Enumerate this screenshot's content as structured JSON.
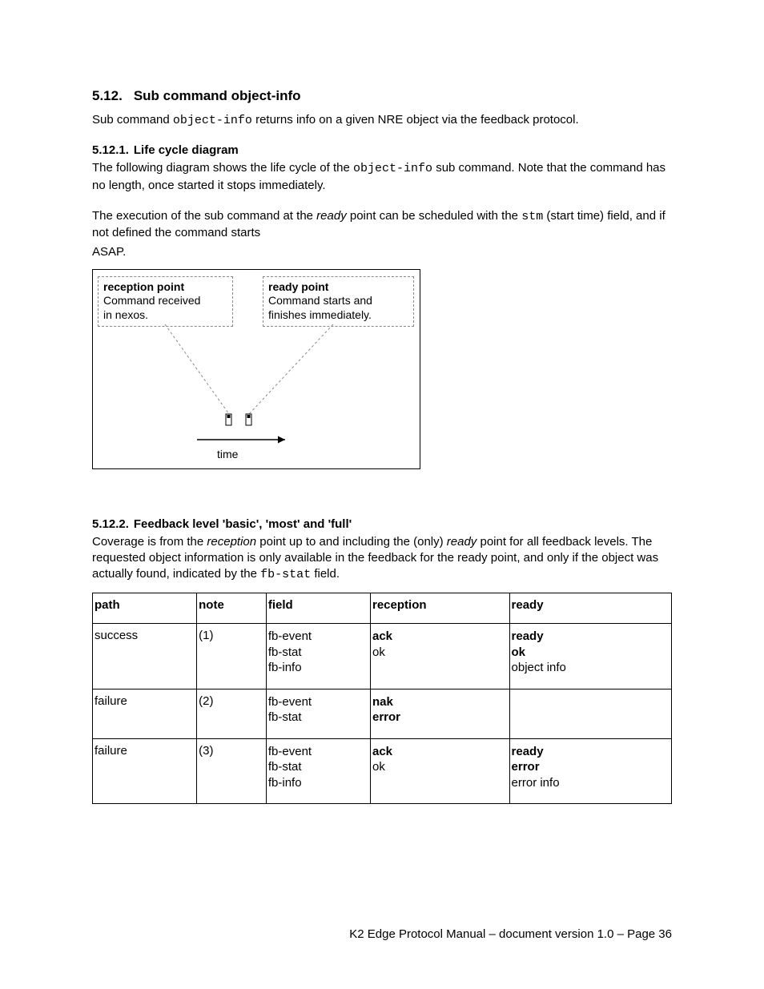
{
  "section": {
    "number": "5.12.",
    "title": "Sub command object-info"
  },
  "intro": {
    "pre": "Sub command ",
    "code": "object-info",
    "post": " returns info on a given NRE object via the feedback protocol."
  },
  "sub1": {
    "number": "5.12.1.",
    "title": "Life cycle diagram",
    "p1a": "The following diagram shows the life cycle of the ",
    "p1code": "object-info",
    "p1b": " sub command. Note that the command has no length, once started it stops immediately.",
    "p2a": "The execution of the sub command at the ",
    "p2em": "ready",
    "p2b": " point can be scheduled with the ",
    "p2code": "stm",
    "p2c": " (start time) field, and if not defined the command starts",
    "p2d": "ASAP."
  },
  "diagram": {
    "box1_title": "reception  point",
    "box1_l1": "Command received",
    "box1_l2": "in nexos.",
    "box2_title": "ready point",
    "box2_l1": "Command starts and",
    "box2_l2": "finishes immediately.",
    "time_label": "time"
  },
  "sub2": {
    "number": "5.12.2.",
    "title": "Feedback level 'basic', 'most' and 'full'",
    "p1a": "Coverage is from the ",
    "p1em1": "reception",
    "p1b": " point up to and including the (only) ",
    "p1em2": "ready",
    "p1c": " point for all feedback levels. The requested object information is only available in the feedback for the ready point, and only if the object was actually found, indicated by the ",
    "p1code": "fb-stat",
    "p1d": " field."
  },
  "table": {
    "headers": {
      "c0": "path",
      "c1": "note",
      "c2": "field",
      "c3": "reception",
      "c4": "ready"
    },
    "rows": [
      {
        "path": "success",
        "note": "(1)",
        "field": [
          "fb-event",
          "fb-stat",
          "fb-info"
        ],
        "reception": [
          {
            "t": "ack",
            "b": true
          },
          {
            "t": "ok",
            "b": false
          }
        ],
        "ready": [
          {
            "t": "ready",
            "b": true
          },
          {
            "t": "ok",
            "b": true
          },
          {
            "t": "object info",
            "b": false
          }
        ]
      },
      {
        "path": "failure",
        "note": "(2)",
        "field": [
          "fb-event",
          "fb-stat"
        ],
        "reception": [
          {
            "t": "nak",
            "b": true
          },
          {
            "t": "error",
            "b": true
          }
        ],
        "ready": []
      },
      {
        "path": "failure",
        "note": "(3)",
        "field": [
          "fb-event",
          "fb-stat",
          "fb-info"
        ],
        "reception": [
          {
            "t": "ack",
            "b": true
          },
          {
            "t": "ok",
            "b": false
          }
        ],
        "ready": [
          {
            "t": "ready",
            "b": true
          },
          {
            "t": "error",
            "b": true
          },
          {
            "t": "error info",
            "b": false
          }
        ]
      }
    ]
  },
  "footer": "K2 Edge Protocol Manual – document version 1.0 – Page 36"
}
